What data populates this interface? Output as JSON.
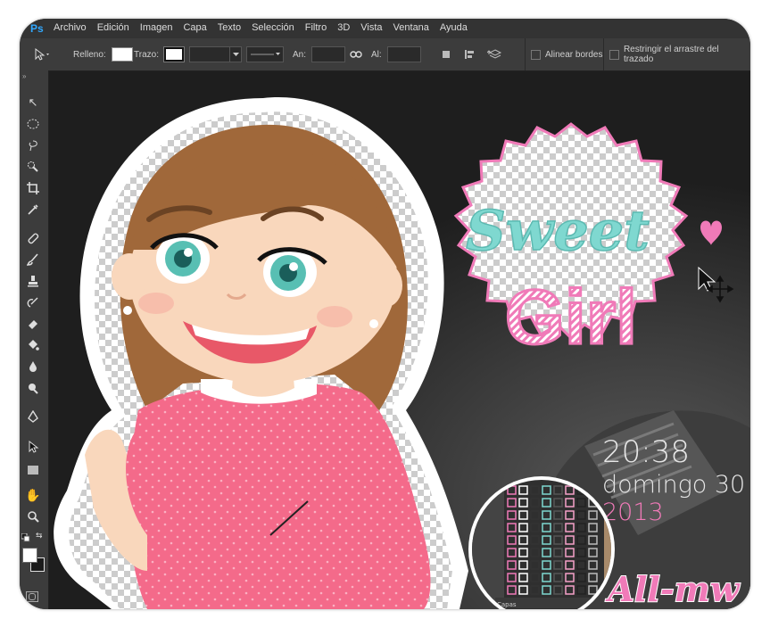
{
  "app": {
    "logo": "Ps"
  },
  "menubar": {
    "items": [
      "Archivo",
      "Edición",
      "Imagen",
      "Capa",
      "Texto",
      "Selección",
      "Filtro",
      "3D",
      "Vista",
      "Ventana",
      "Ayuda"
    ]
  },
  "options": {
    "fill_label": "Relleno:",
    "stroke_label": "Trazo:",
    "width_label": "An:",
    "height_label": "Al:",
    "align_edges": "Alinear bordes",
    "constrain_path": "Restringir el arrastre del trazado"
  },
  "artwork": {
    "title_line1": "Sweet",
    "title_line2": "Girl",
    "signature": "All-mw",
    "time": "20:38",
    "date": "domingo 30",
    "year": "2013",
    "layers_label": "Capas"
  },
  "colors": {
    "accent_teal": "#7fd8d0",
    "accent_pink": "#f07ab8",
    "shirt_pink": "#f46a8a",
    "hair_brown": "#a0683a"
  }
}
